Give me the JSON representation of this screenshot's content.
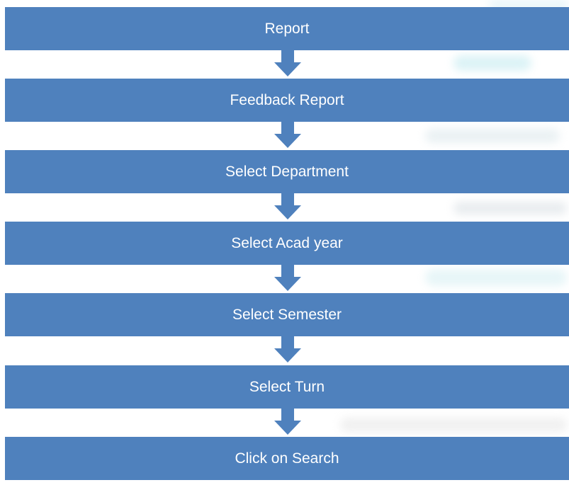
{
  "flowchart": {
    "steps": [
      {
        "label": "Report"
      },
      {
        "label": "Feedback Report"
      },
      {
        "label": "Select Department"
      },
      {
        "label": "Select Acad year"
      },
      {
        "label": "Select Semester"
      },
      {
        "label": "Select Turn"
      },
      {
        "label": "Click on Search"
      }
    ],
    "box_color": "#4f81bd",
    "arrow_color": "#4f81bd",
    "text_color": "#ffffff"
  }
}
